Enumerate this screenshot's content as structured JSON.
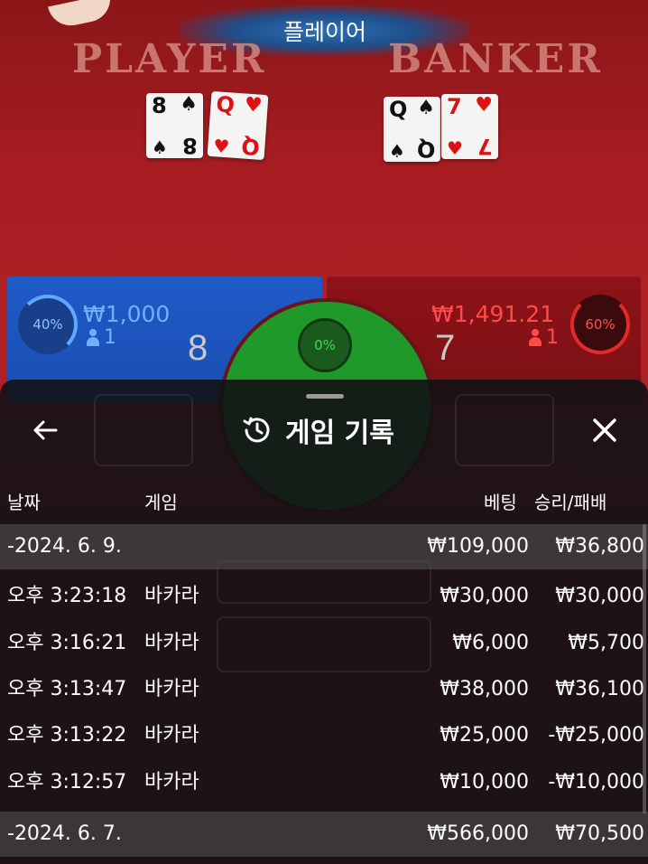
{
  "game": {
    "status_banner": "플레이어",
    "player_title": "PLAYER",
    "banker_title": "BANKER",
    "player_cards": [
      {
        "rank": "8",
        "suit": "♠",
        "color": "black"
      },
      {
        "rank": "Q",
        "suit": "♥",
        "color": "red"
      }
    ],
    "banker_cards": [
      {
        "rank": "Q",
        "suit": "♠",
        "color": "black"
      },
      {
        "rank": "7",
        "suit": "♥",
        "color": "red"
      }
    ],
    "player": {
      "percent": "40%",
      "amount": "₩1,000",
      "players": "1",
      "score": "8"
    },
    "banker": {
      "percent": "60%",
      "amount": "₩1,491.21",
      "players": "1",
      "score": "7"
    },
    "tie_percent": "0%",
    "colors": {
      "player_blue": "#1f5ac8",
      "banker_red": "#8e1318",
      "tie_green": "#1f9a2a"
    }
  },
  "history": {
    "title": "게임 기록",
    "back_icon": "arrow-left-icon",
    "history_icon": "history-icon",
    "close_icon": "close-icon",
    "columns": {
      "date": "날짜",
      "game": "게임",
      "bet": "베팅",
      "win_loss": "승리/패배"
    },
    "rows": [
      {
        "type": "date",
        "time": "-2024. 6. 9.",
        "game": "",
        "bet": "₩109,000",
        "win": "₩36,800"
      },
      {
        "type": "entry",
        "time": "오후 3:23:18",
        "game": "바카라",
        "bet": "₩30,000",
        "win": "₩30,000"
      },
      {
        "type": "entry",
        "time": "오후 3:16:21",
        "game": "바카라",
        "bet": "₩6,000",
        "win": "₩5,700"
      },
      {
        "type": "entry",
        "time": "오후 3:13:47",
        "game": "바카라",
        "bet": "₩38,000",
        "win": "₩36,100"
      },
      {
        "type": "entry",
        "time": "오후 3:13:22",
        "game": "바카라",
        "bet": "₩25,000",
        "win": "-₩25,000"
      },
      {
        "type": "entry",
        "time": "오후 3:12:57",
        "game": "바카라",
        "bet": "₩10,000",
        "win": "-₩10,000"
      },
      {
        "type": "date",
        "time": "-2024. 6. 7.",
        "game": "",
        "bet": "₩566,000",
        "win": "₩70,500"
      }
    ]
  }
}
